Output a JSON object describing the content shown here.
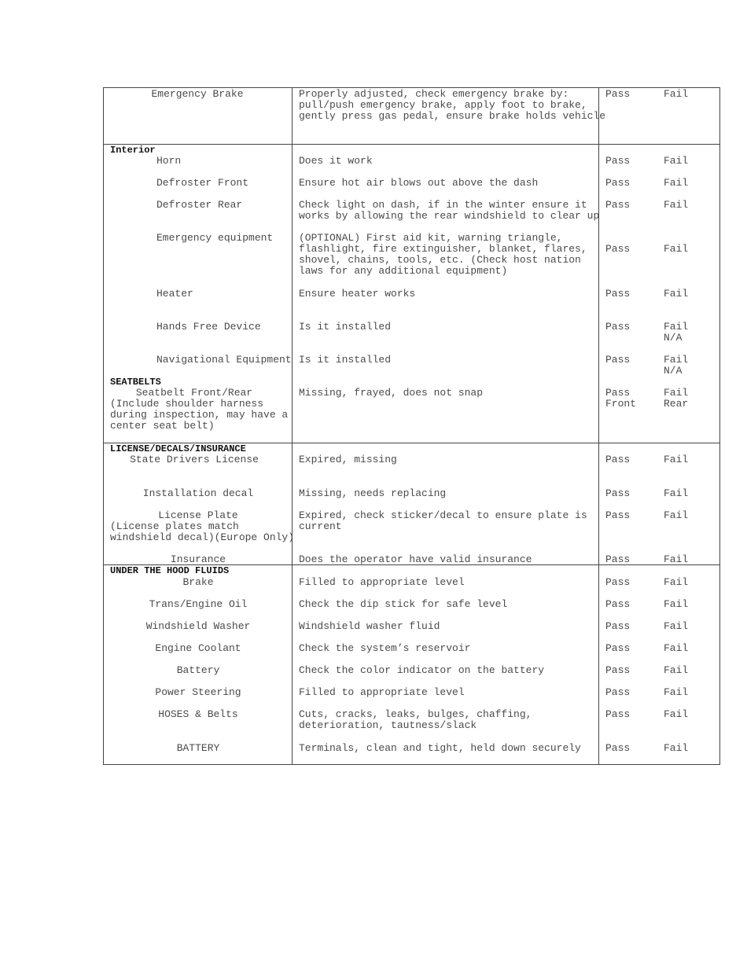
{
  "sections": [
    {
      "header": "",
      "rows": [
        {
          "item": "Emergency Brake",
          "description": "Properly adjusted, check emergency brake by:\npull/push emergency brake, apply foot to brake,\ngently press gas pedal, ensure brake holds vehicle",
          "pass": "Pass",
          "fail": "Fail"
        }
      ]
    },
    {
      "header": "Interior",
      "rows": [
        {
          "item": "Horn",
          "description": "Does it work",
          "pass": "Pass",
          "fail": "Fail"
        },
        {
          "item": "Defroster Front",
          "description": "Ensure hot air blows out above the dash",
          "pass": "Pass",
          "fail": "Fail"
        },
        {
          "item": "Defroster Rear",
          "description": "Check light on dash, if in the winter ensure it\nworks by allowing the rear windshield to clear up",
          "pass": "Pass",
          "fail": "Fail"
        },
        {
          "item": "Emergency equipment",
          "description": "(OPTIONAL) First aid kit, warning triangle,\nflashlight, fire extinguisher, blanket, flares,\nshovel, chains, tools, etc. (Check host nation\nlaws for any additional equipment)",
          "pass": "Pass",
          "fail": "Fail"
        },
        {
          "item": "Heater",
          "description": "Ensure heater works",
          "pass": "Pass",
          "fail": "Fail"
        },
        {
          "item": "Hands Free Device",
          "description": "Is it installed",
          "pass": "Pass",
          "fail": "Fail\nN/A"
        },
        {
          "item": "Navigational Equipment",
          "description": "Is it installed",
          "pass": "Pass",
          "fail": "Fail\nN/A"
        }
      ]
    },
    {
      "header": "SEATBELTS",
      "rows": [
        {
          "item": "Seatbelt Front/Rear",
          "item_note": "(Include shoulder harness\nduring inspection, may have a\ncenter seat belt)",
          "description": "Missing, frayed, does not snap",
          "pass": "Pass\nFront",
          "fail": "Fail\nRear"
        }
      ]
    },
    {
      "header": "LICENSE/DECALS/INSURANCE",
      "rows": [
        {
          "item": "State Drivers License",
          "description": "Expired, missing",
          "pass": "Pass",
          "fail": "Fail"
        },
        {
          "item": "Installation decal",
          "description": "Missing, needs replacing",
          "pass": "Pass",
          "fail": "Fail"
        },
        {
          "item": "License Plate",
          "item_note": "(License plates match\nwindshield decal)(Europe Only)",
          "description": "Expired, check sticker/decal to ensure plate is\ncurrent",
          "pass": "Pass",
          "fail": "Fail"
        },
        {
          "item": "Insurance",
          "description": "Does the operator have valid insurance",
          "pass": "Pass",
          "fail": "Fail"
        }
      ]
    },
    {
      "header": "UNDER THE HOOD FLUIDS",
      "rows": [
        {
          "item": "Brake",
          "description": "Filled to appropriate level",
          "pass": "Pass",
          "fail": "Fail"
        },
        {
          "item": "Trans/Engine Oil",
          "description": "Check the dip stick for safe level",
          "pass": "Pass",
          "fail": "Fail"
        },
        {
          "item": "Windshield Washer",
          "description": "Windshield washer fluid",
          "pass": "Pass",
          "fail": "Fail"
        },
        {
          "item": "Engine Coolant",
          "description": "Check the system’s reservoir",
          "pass": "Pass",
          "fail": "Fail"
        },
        {
          "item": "Battery",
          "description": "Check the color indicator on the battery",
          "pass": "Pass",
          "fail": "Fail"
        },
        {
          "item": "Power Steering",
          "description": "Filled to appropriate level",
          "pass": "Pass",
          "fail": "Fail"
        },
        {
          "item": "HOSES & Belts",
          "description": "Cuts, cracks, leaks, bulges, chaffing,\ndeterioration, tautness/slack",
          "pass": "Pass",
          "fail": "Fail"
        },
        {
          "item": "BATTERY",
          "description": "Terminals, clean and tight, held down securely",
          "pass": "Pass",
          "fail": "Fail"
        }
      ]
    }
  ]
}
